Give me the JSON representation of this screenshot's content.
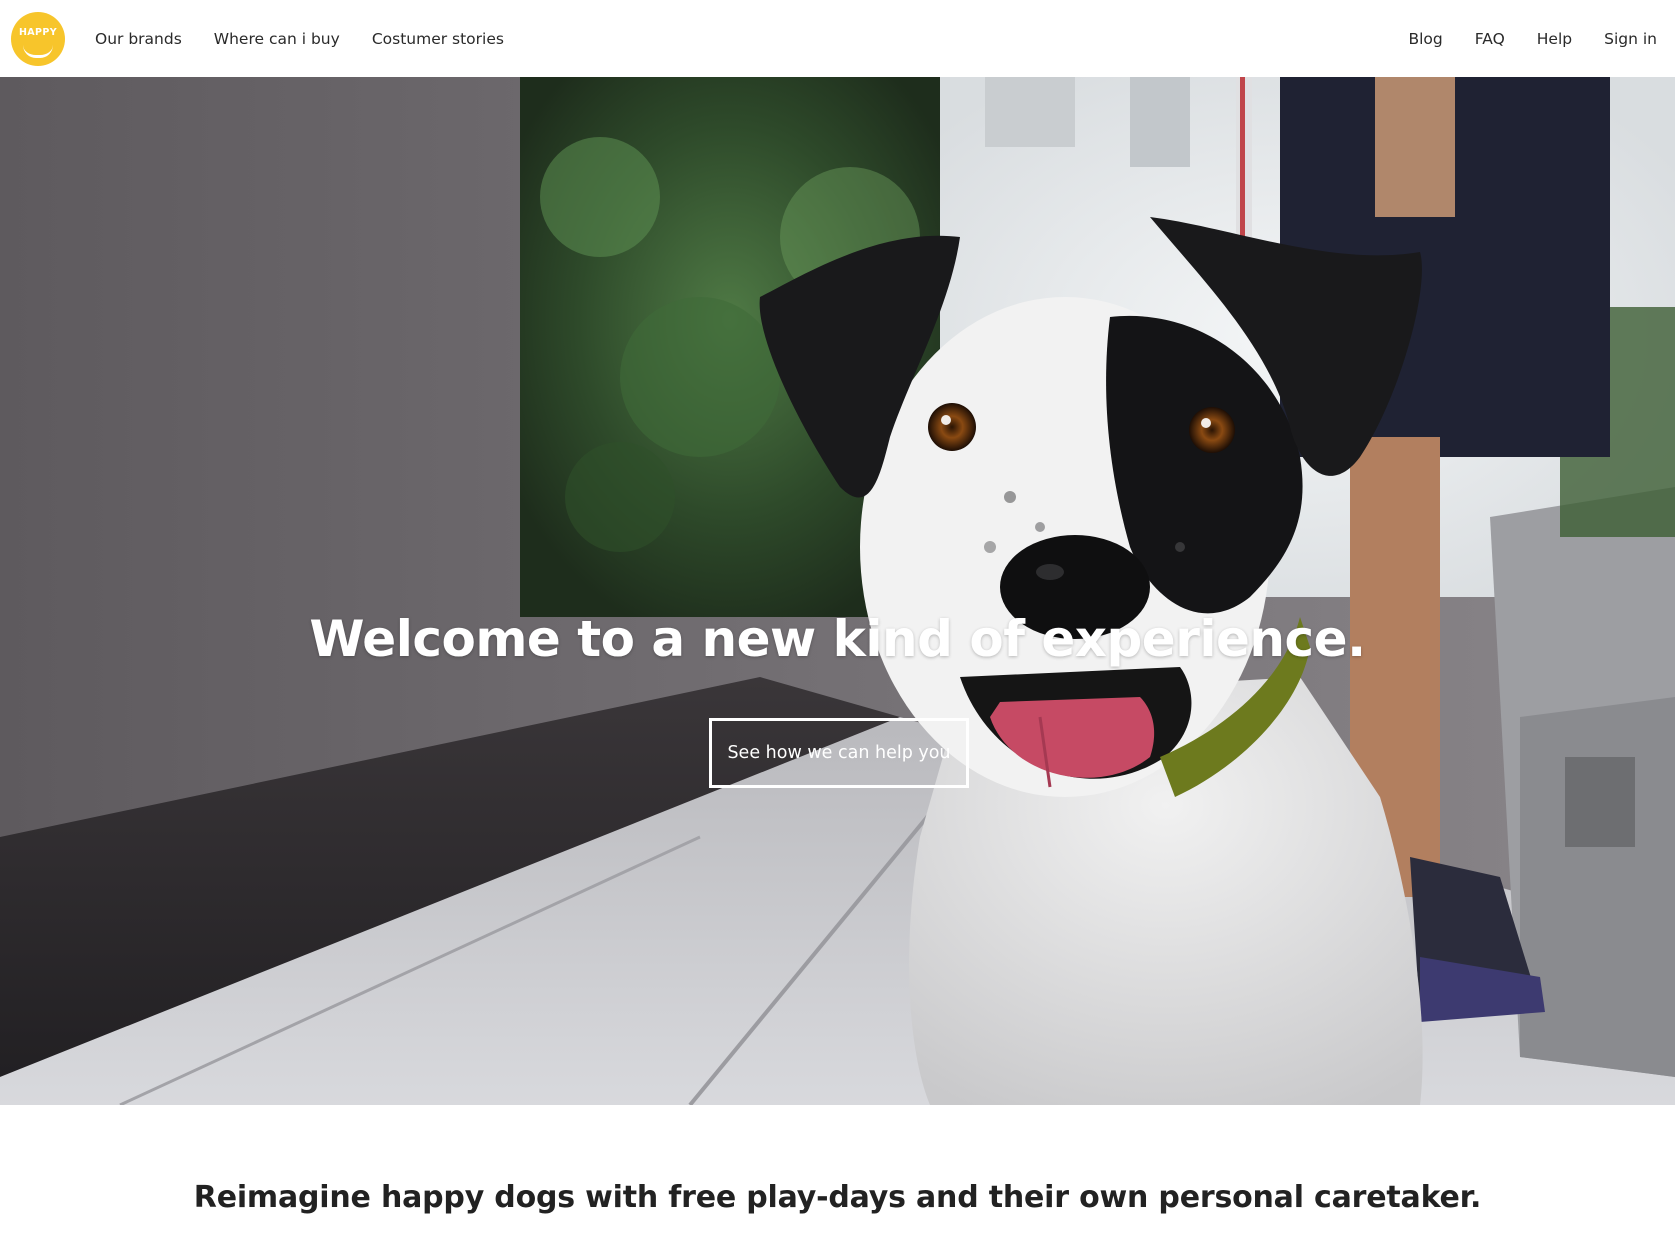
{
  "brand": {
    "logo_text": "HAPPY",
    "accent_color": "#f7c52b"
  },
  "nav": {
    "left_links": [
      "Our brands",
      "Where can i buy",
      "Costumer stories"
    ],
    "right_links": [
      "Blog",
      "FAQ",
      "Help",
      "Sign in"
    ]
  },
  "hero": {
    "title": "Welcome to a new kind of experience.",
    "button_label": "See how we can help you",
    "image": "dog-photo"
  },
  "tagline": "Reimagine happy dogs with free play-days and their own personal caretaker."
}
